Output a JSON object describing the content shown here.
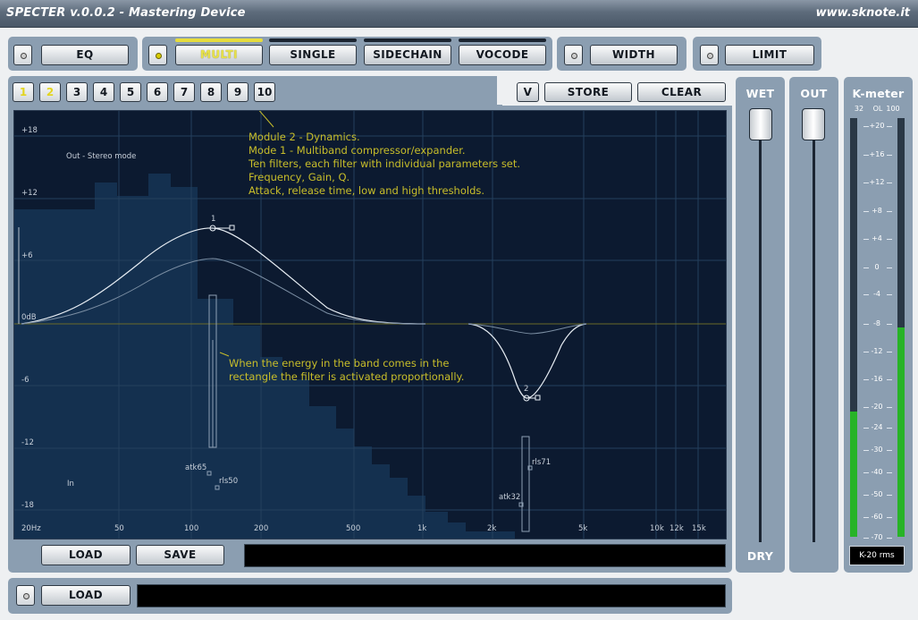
{
  "window": {
    "title": "SPECTER v.0.0.2 - Mastering Device",
    "url": "www.sknote.it"
  },
  "modules": {
    "eq": "EQ",
    "tabs": [
      {
        "label": "MULTI",
        "active": true
      },
      {
        "label": "SINGLE",
        "active": false
      },
      {
        "label": "SIDECHAIN",
        "active": false
      },
      {
        "label": "VOCODE",
        "active": false
      }
    ],
    "width": "WIDTH",
    "limit": "LIMIT"
  },
  "filters": {
    "numbers": [
      "1",
      "2",
      "3",
      "4",
      "5",
      "6",
      "7",
      "8",
      "9",
      "10"
    ],
    "active": [
      "1",
      "2"
    ]
  },
  "preset": {
    "v": "V",
    "store": "STORE",
    "clear": "CLEAR"
  },
  "graph": {
    "ylabels": [
      "+18",
      "+12",
      "+6",
      "0dB",
      "-6",
      "-12",
      "-18"
    ],
    "xlabels": [
      "20Hz",
      "50",
      "100",
      "200",
      "500",
      "1k",
      "2k",
      "5k",
      "10k",
      "12k",
      "15k"
    ],
    "mode": "Out - Stereo mode",
    "in": "In",
    "band1": "1",
    "band2": "2",
    "atk1": "atk65",
    "rls1": "rls50",
    "atk2": "atk32",
    "rls2": "rls71",
    "note1": "Module 2 - Dynamics.\nMode 1 - Multiband compressor/expander.\nTen filters, each filter with individual parameters set.\nFrequency, Gain, Q.\nAttack, release time, low and high thresholds.",
    "note2": "When the energy in the band comes in the\nrectangle the filter is activated proportionally."
  },
  "bottom": {
    "load": "LOAD",
    "save": "SAVE",
    "load2": "LOAD"
  },
  "wet": {
    "label": "WET",
    "dry": "DRY"
  },
  "out": {
    "label": "OUT"
  },
  "kmeter": {
    "label": "K-meter",
    "sublabels": [
      "32",
      "OL",
      "100"
    ],
    "scale": [
      "+20",
      "+16",
      "+12",
      "+8",
      "+4",
      "0",
      "-4",
      "-8",
      "-12",
      "-16",
      "-20",
      "-24",
      "-30",
      "-40",
      "-50",
      "-60",
      "-70"
    ],
    "mode": "K-20 rms",
    "left_level": 0.3,
    "right_level": 0.5
  }
}
